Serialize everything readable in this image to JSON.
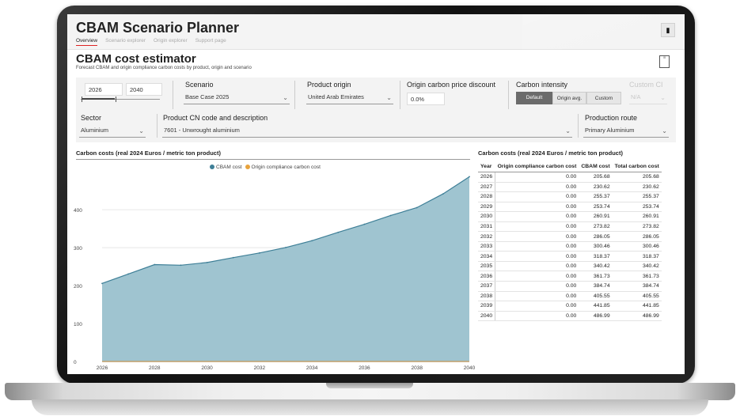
{
  "app": {
    "title": "CBAM Scenario Planner"
  },
  "tabs": [
    "Overview",
    "Scenario explorer",
    "Origin explorer",
    "Support page"
  ],
  "section": {
    "title": "CBAM cost estimator",
    "subtitle": "Forecast CBAM and origin compliance carbon costs by product, origin and scenario"
  },
  "filters": {
    "year_start": "2026",
    "year_end": "2040",
    "scenario_label": "Scenario",
    "scenario_value": "Base Case 2025",
    "origin_label": "Product origin",
    "origin_value": "United Arab Emirates",
    "discount_label": "Origin carbon price discount",
    "discount_value": "0.0%",
    "intensity_label": "Carbon intensity",
    "intensity_buttons": [
      "Default",
      "Origin avg.",
      "Custom"
    ],
    "custom_ci_label": "Custom CI",
    "custom_ci_value": "N/A",
    "sector_label": "Sector",
    "sector_value": "Aluminium",
    "cn_label": "Product CN code and description",
    "cn_value": "7601 - Unwrought aluminium",
    "route_label": "Production route",
    "route_value": "Primary Aluminium"
  },
  "colors": {
    "cbam": "#9fc4d0",
    "cbam_line": "#3e7f97",
    "origin": "#e8a33d",
    "accent": "#d22222"
  },
  "chart_data": {
    "type": "area",
    "title": "Carbon costs (real 2024 Euros / metric ton product)",
    "x": [
      2026,
      2027,
      2028,
      2029,
      2030,
      2031,
      2032,
      2033,
      2034,
      2035,
      2036,
      2037,
      2038,
      2039,
      2040
    ],
    "x_ticks": [
      "2026",
      "2028",
      "2030",
      "2032",
      "2034",
      "2036",
      "2038",
      "2040"
    ],
    "y_ticks": [
      "0",
      "100",
      "200",
      "300",
      "400"
    ],
    "ylim": [
      0,
      490
    ],
    "legend_placement": "top-center",
    "series": [
      {
        "name": "CBAM cost",
        "values": [
          205.68,
          230.62,
          255.37,
          253.74,
          260.91,
          273.82,
          286.05,
          300.46,
          318.37,
          340.42,
          361.73,
          384.74,
          405.55,
          441.85,
          486.99
        ]
      },
      {
        "name": "Origin compliance carbon cost",
        "values": [
          0,
          0,
          0,
          0,
          0,
          0,
          0,
          0,
          0,
          0,
          0,
          0,
          0,
          0,
          0
        ]
      }
    ]
  },
  "table": {
    "title": "Carbon costs (real 2024 Euros / metric ton product)",
    "headers": [
      "Year",
      "Origin compliance carbon cost",
      "CBAM cost",
      "Total carbon cost"
    ],
    "rows": [
      [
        "2026",
        "0.00",
        "205.68",
        "205.68"
      ],
      [
        "2027",
        "0.00",
        "230.62",
        "230.62"
      ],
      [
        "2028",
        "0.00",
        "255.37",
        "255.37"
      ],
      [
        "2029",
        "0.00",
        "253.74",
        "253.74"
      ],
      [
        "2030",
        "0.00",
        "260.91",
        "260.91"
      ],
      [
        "2031",
        "0.00",
        "273.82",
        "273.82"
      ],
      [
        "2032",
        "0.00",
        "286.05",
        "286.05"
      ],
      [
        "2033",
        "0.00",
        "300.46",
        "300.46"
      ],
      [
        "2034",
        "0.00",
        "318.37",
        "318.37"
      ],
      [
        "2035",
        "0.00",
        "340.42",
        "340.42"
      ],
      [
        "2036",
        "0.00",
        "361.73",
        "361.73"
      ],
      [
        "2037",
        "0.00",
        "384.74",
        "384.74"
      ],
      [
        "2038",
        "0.00",
        "405.55",
        "405.55"
      ],
      [
        "2039",
        "0.00",
        "441.85",
        "441.85"
      ],
      [
        "2040",
        "0.00",
        "486.99",
        "486.99"
      ]
    ]
  }
}
